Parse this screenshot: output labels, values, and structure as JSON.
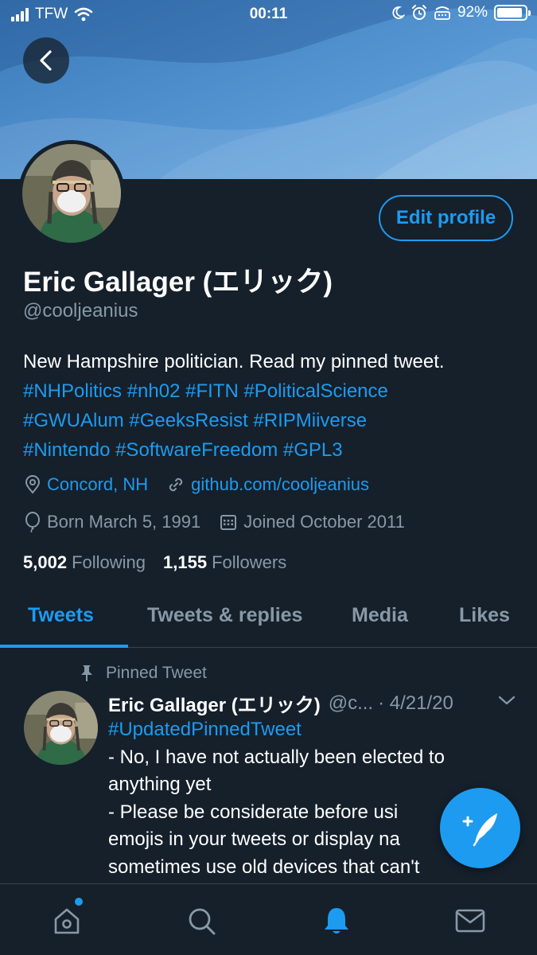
{
  "status_bar": {
    "carrier": "TFW",
    "time": "00:11",
    "battery": "92%",
    "battery_level": 0.92
  },
  "profile": {
    "name": "Eric Gallager (エリック)",
    "handle": "@cooljeanius",
    "edit_button": "Edit profile",
    "bio": {
      "text": "New Hampshire politician. Read my pinned tweet.",
      "hashtag_lines": [
        "#NHPolitics #nh02 #FITN #PoliticalScience",
        "#GWUAlum #GeeksResist #RIPMiiverse",
        "#Nintendo #SoftwareFreedom #GPL3"
      ]
    },
    "location": "Concord, NH",
    "website": "github.com/cooljeanius",
    "birthday": "Born March 5, 1991",
    "joined": "Joined October 2011",
    "following_count": "5,002",
    "following_label": "Following",
    "followers_count": "1,155",
    "followers_label": "Followers"
  },
  "tabs": [
    {
      "label": "Tweets",
      "active": true
    },
    {
      "label": "Tweets & replies",
      "active": false
    },
    {
      "label": "Media",
      "active": false
    },
    {
      "label": "Likes",
      "active": false
    }
  ],
  "pinned_tweet": {
    "label": "Pinned Tweet",
    "author": "Eric Gallager (エリック)",
    "handle": "@c...",
    "date": "· 4/21/20",
    "hashtag": "#UpdatedPinnedTweet",
    "lines": [
      "- No, I have not actually been elected to",
      "anything yet",
      "- Please be considerate before usi",
      "emojis in your tweets or display na",
      "sometimes use old devices that can't"
    ]
  },
  "colors": {
    "background": "#15202b",
    "accent": "#1d9bf0",
    "secondary_text": "#8899a6",
    "divider": "#38444d"
  },
  "icons": {
    "back": "back-arrow-icon",
    "location": "location-pin-icon",
    "link": "link-icon",
    "birthday": "balloon-icon",
    "calendar": "calendar-icon",
    "pin": "pin-icon",
    "caret": "chevron-down-icon",
    "compose": "compose-tweet-icon",
    "home": "home-icon",
    "search": "search-icon",
    "notifications": "bell-icon",
    "messages": "mail-icon"
  }
}
